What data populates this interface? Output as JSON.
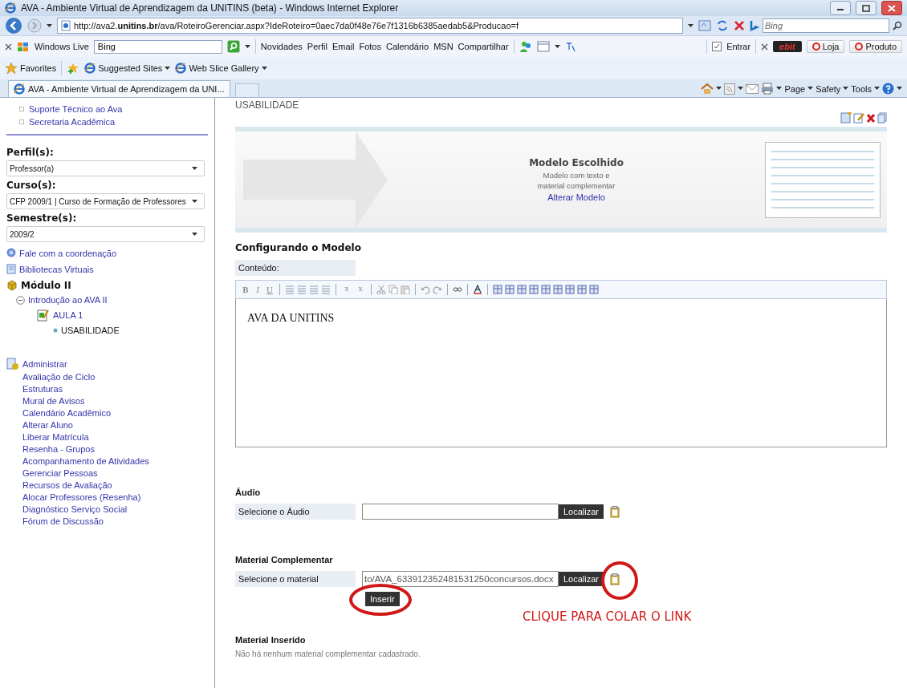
{
  "window": {
    "title": "AVA - Ambiente Virtual de Aprendizagem da UNITINS (beta) - Windows Internet Explorer"
  },
  "address_bar": {
    "url": "http://ava2.**unitins.br**/ava/RoteiroGerenciar.aspx?IdeRoteiro=0aec7da0f48e76e7f1316b6385aedab5&Producao=f",
    "search_placeholder": "Bing"
  },
  "live_toolbar": {
    "brand": "Windows Live",
    "search_value": "Bing",
    "links": [
      "Novidades",
      "Perfil",
      "Email",
      "Fotos",
      "Calendário",
      "MSN",
      "Compartilhar"
    ],
    "signin": "Entrar",
    "ebit": "ebit",
    "buttons": [
      "Loja",
      "Produto"
    ]
  },
  "favorites_bar": {
    "favorites": "Favorites",
    "items": [
      "Suggested Sites",
      "Web Slice Gallery"
    ]
  },
  "tabs": [
    {
      "label": "AVA - Ambiente Virtual de Aprendizagem da UNI...",
      "selected": true
    }
  ],
  "command_bar": {
    "menus": [
      "Page",
      "Safety",
      "Tools"
    ]
  },
  "sidebar": {
    "links": [
      "Suporte Técnico ao Ava",
      "Secretaria Acadêmica"
    ],
    "filters": [
      {
        "label": "Perfil(s):",
        "value": "Professor(a)"
      },
      {
        "label": "Curso(s):",
        "value": "CFP 2009/1 | Curso de Formação de Professores"
      },
      {
        "label": "Semestre(s):",
        "value": "2009/2"
      }
    ],
    "quick_links": [
      {
        "kind": "contact",
        "label": "Fale com a coordenação"
      },
      {
        "kind": "library",
        "label": "Bibliotecas Virtuais"
      }
    ],
    "tree": [
      {
        "kind": "module",
        "label": "Módulo II",
        "children": [
          {
            "kind": "unit",
            "label": "Introdução ao AVA II",
            "expanded": true,
            "children": [
              {
                "kind": "lesson",
                "label": "AULA 1",
                "children": [
                  {
                    "kind": "topic",
                    "label": "USABILIDADE"
                  }
                ]
              }
            ]
          }
        ]
      }
    ],
    "admin": {
      "label": "Administrar",
      "items": [
        "Avaliação de Ciclo",
        "Estruturas",
        "Mural de Avisos",
        "Calendário Acadêmico",
        "Alterar Aluno",
        "Liberar Matrícula",
        "Resenha - Grupos",
        "Acompanhamento de Atividades",
        "Gerenciar Pessoas",
        "Recursos de Avaliação",
        "Alocar Professores (Resenha)",
        "Diagnóstico Serviço Social",
        "Fórum de Discussão"
      ]
    }
  },
  "main": {
    "heading": "USABILIDADE",
    "model": {
      "title": "Modelo Escolhido",
      "description": "Modelo com texto e material complementar",
      "link": "Alterar Modelo"
    },
    "config_title": "Configurando o Modelo",
    "content_label": "Conteúdo:",
    "toolbar": [
      {
        "kind": "letter",
        "label": "B"
      },
      {
        "kind": "letter",
        "label": "I"
      },
      {
        "kind": "letter",
        "label": "U"
      },
      {
        "kind": "sep"
      },
      {
        "kind": "align"
      },
      {
        "kind": "align"
      },
      {
        "kind": "align"
      },
      {
        "kind": "align"
      },
      {
        "kind": "sep"
      },
      {
        "kind": "script",
        "label": "x"
      },
      {
        "kind": "script",
        "label": "x"
      },
      {
        "kind": "sep"
      },
      {
        "kind": "cut"
      },
      {
        "kind": "copy"
      },
      {
        "kind": "paste"
      },
      {
        "kind": "sep"
      },
      {
        "kind": "undo"
      },
      {
        "kind": "redo"
      },
      {
        "kind": "sep"
      },
      {
        "kind": "link"
      },
      {
        "kind": "sep"
      },
      {
        "kind": "color"
      },
      {
        "kind": "sep"
      },
      {
        "kind": "table"
      },
      {
        "kind": "table"
      },
      {
        "kind": "table"
      },
      {
        "kind": "table"
      },
      {
        "kind": "table"
      },
      {
        "kind": "table"
      },
      {
        "kind": "table"
      },
      {
        "kind": "table"
      },
      {
        "kind": "table"
      }
    ],
    "editor_text": "AVA DA UNITINS",
    "audio": {
      "title": "Áudio",
      "label": "Selecione o Áudio",
      "button": "Localizar"
    },
    "material": {
      "title": "Material Complementar",
      "label": "Selecione o material",
      "value": "to/AVA_633912352481531250concursos.docx",
      "button": "Localizar",
      "insert": "Inserir"
    },
    "annotation": "CLIQUE PARA COLAR O LINK",
    "inserted": {
      "title": "Material Inserido",
      "empty_text": "Não há nenhum material complementar cadastrado."
    }
  }
}
